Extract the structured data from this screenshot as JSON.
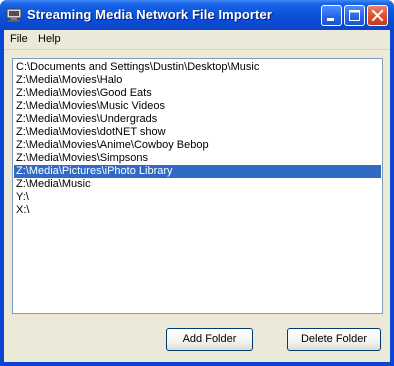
{
  "window": {
    "title": "Streaming Media Network File Importer"
  },
  "titlebar_buttons": {
    "minimize": "minimize-icon",
    "maximize": "maximize-icon",
    "close": "close-icon"
  },
  "menu": {
    "items": [
      "File",
      "Help"
    ]
  },
  "folder_list": {
    "items": [
      "C:\\Documents and Settings\\Dustin\\Desktop\\Music",
      "Z:\\Media\\Movies\\Halo",
      "Z:\\Media\\Movies\\Good Eats",
      "Z:\\Media\\Movies\\Music Videos",
      "Z:\\Media\\Movies\\Undergrads",
      "Z:\\Media\\Movies\\dotNET show",
      "Z:\\Media\\Movies\\Anime\\Cowboy Bebop",
      "Z:\\Media\\Movies\\Simpsons",
      "Z:\\Media\\Pictures\\iPhoto Library",
      "Z:\\Media\\Music",
      "Y:\\",
      "X:\\"
    ],
    "selected": "Z:\\Media\\Pictures\\iPhoto Library"
  },
  "buttons": {
    "add": "Add Folder",
    "delete": "Delete Folder"
  },
  "colors": {
    "titlebar": "#0a54dd",
    "selection": "#316ac5",
    "face": "#ece9d8"
  }
}
